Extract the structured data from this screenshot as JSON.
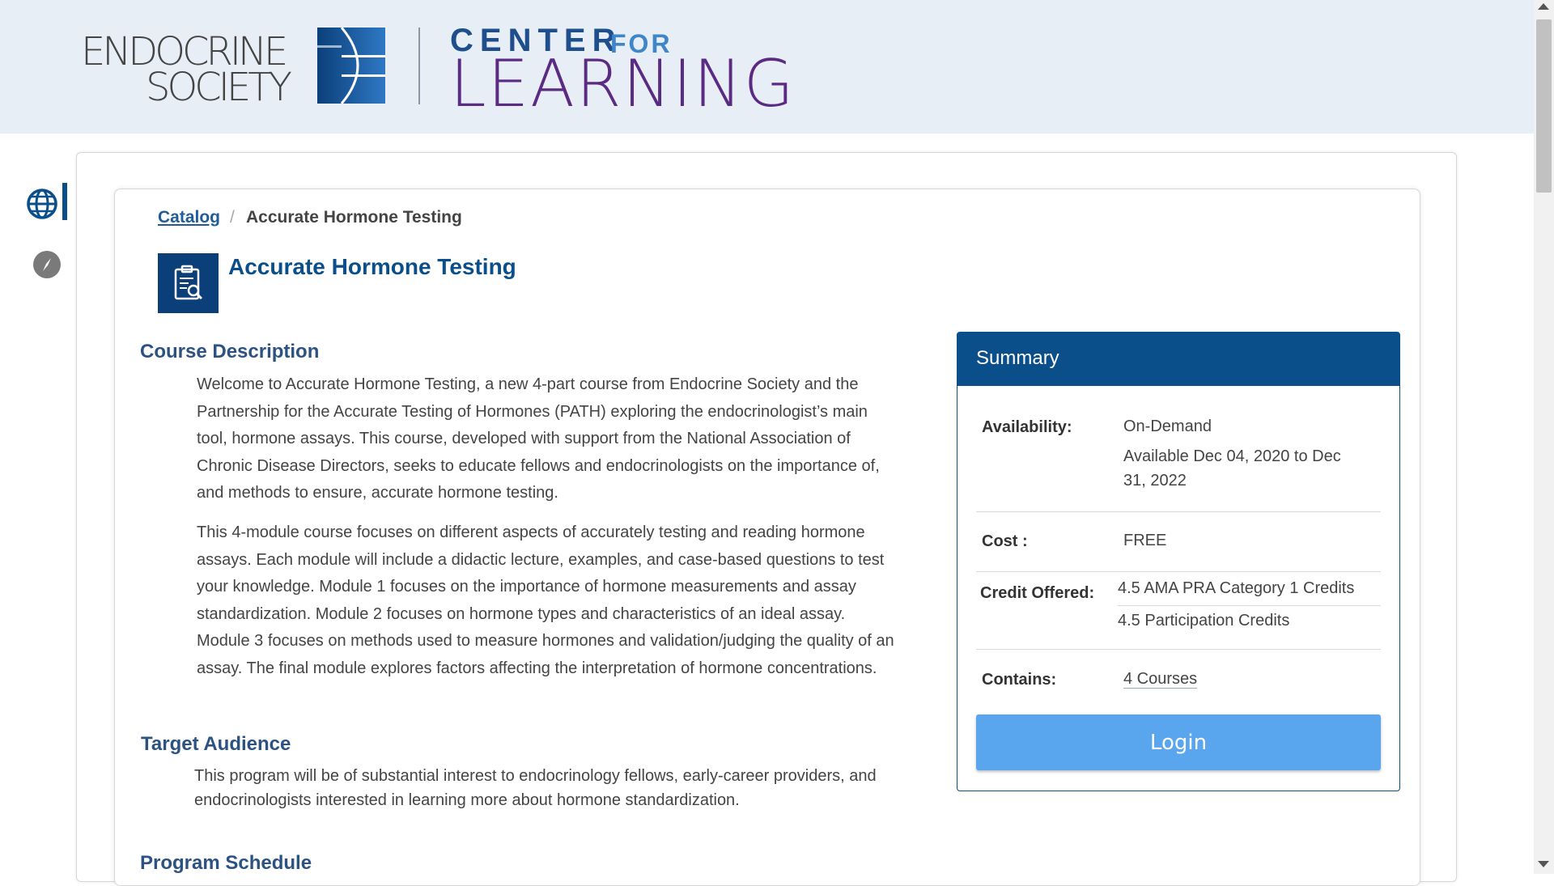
{
  "header": {
    "logo_endo_line1": "ENDOCRINE",
    "logo_endo_line2": "SOCIETY",
    "logo_center": "CENTER",
    "logo_for": "FOR",
    "logo_learning": "LEARNING"
  },
  "rail": {
    "items": [
      {
        "icon": "globe-icon",
        "active": true
      },
      {
        "icon": "compass-icon",
        "active": false
      }
    ]
  },
  "breadcrumb": {
    "root": "Catalog",
    "separator": "/",
    "current": "Accurate Hormone Testing"
  },
  "course": {
    "title": "Accurate Hormone Testing",
    "icon": "clipboard-search-icon"
  },
  "description": {
    "heading": "Course Description",
    "para1_lines": [
      "Welcome to Accurate Hormone Testing, a new 4-part course from Endocrine Society and the",
      "Partnership for the Accurate Testing of Hormones (PATH) exploring the endocrinologist’s main",
      "tool, hormone assays. This course, developed with support from the National Association of",
      "Chronic Disease Directors, seeks to educate fellows and endocrinologists on the importance of,",
      "and methods to ensure, accurate hormone testing."
    ],
    "para2_lines": [
      "This 4-module course focuses on different aspects of accurately testing and reading hormone",
      "assays. Each module will include a didactic lecture, examples, and case-based questions to test",
      "your knowledge. Module 1 focuses on the importance of hormone measurements and assay",
      "standardization. Module 2 focuses on hormone types and characteristics of an ideal assay.",
      "Module 3 focuses on methods used to measure hormones and validation/judging the quality of an",
      "assay. The final module explores factors affecting the interpretation of hormone concentrations."
    ]
  },
  "audience": {
    "heading": "Target Audience",
    "lines": [
      "This program will be of substantial interest to endocrinology fellows, early-career providers, and",
      "endocrinologists interested in learning more about hormone standardization."
    ]
  },
  "schedule": {
    "heading": "Program Schedule"
  },
  "summary": {
    "title": "Summary",
    "availability_label": "Availability:",
    "availability_value": "On-Demand",
    "availability_range_line1": "Available Dec 04, 2020 to Dec",
    "availability_range_line2": "31, 2022",
    "cost_label": "Cost :",
    "cost_value": "FREE",
    "credit_label": "Credit Offered:",
    "credit_values": [
      "4.5 AMA PRA Category 1 Credits",
      "4.5 Participation Credits"
    ],
    "contains_label": "Contains:",
    "contains_value": "4 Courses",
    "login_label": "Login"
  },
  "colors": {
    "primary": "#0b4f8a",
    "button": "#5aa6ee",
    "header_bg": "#e8eef5",
    "learning_purple": "#5b2a82"
  }
}
